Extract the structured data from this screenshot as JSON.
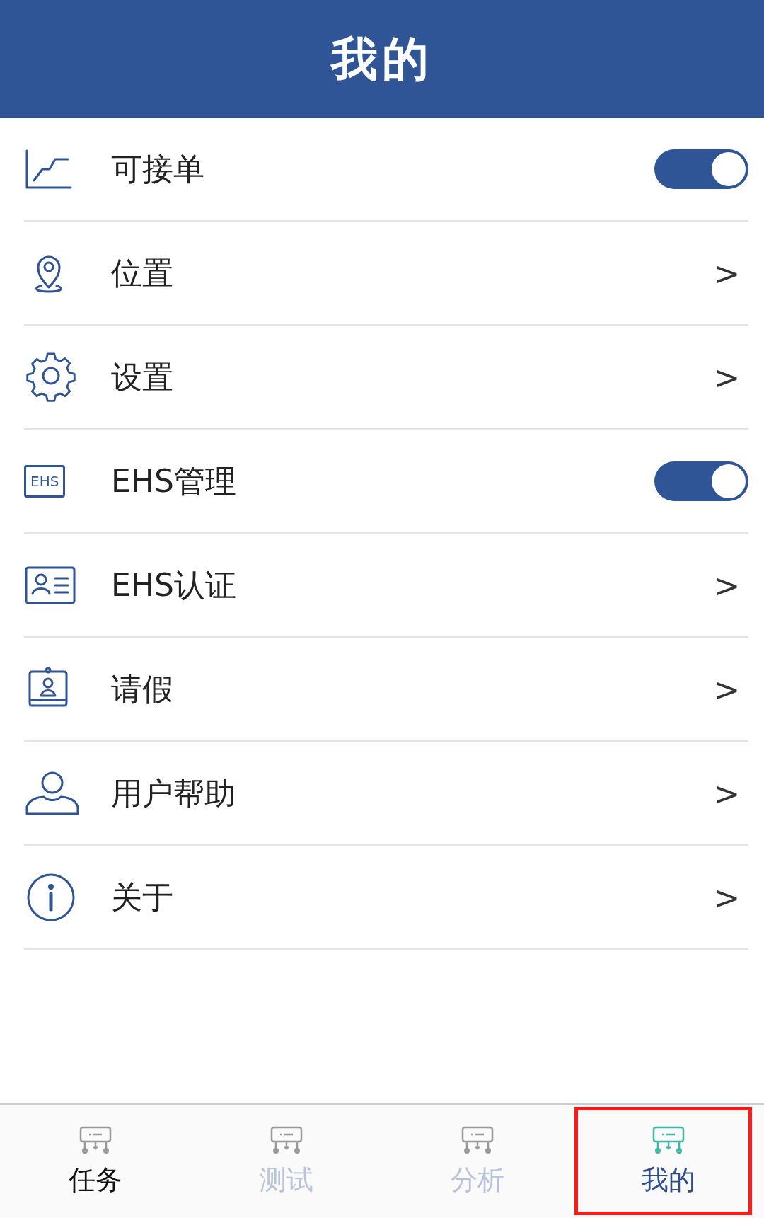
{
  "header": {
    "title": "我的"
  },
  "items": [
    {
      "kind": "toggle",
      "label": "可接单",
      "on": true
    },
    {
      "kind": "link",
      "label": "位置",
      "chevron": ">"
    },
    {
      "kind": "link",
      "label": "设置",
      "chevron": ">"
    },
    {
      "kind": "toggle",
      "label": "EHS管理",
      "on": true,
      "icon_text": "EHS"
    },
    {
      "kind": "link",
      "label": "EHS认证",
      "chevron": ">"
    },
    {
      "kind": "link",
      "label": "请假",
      "chevron": ">"
    },
    {
      "kind": "link",
      "label": "用户帮助",
      "chevron": ">"
    },
    {
      "kind": "link",
      "label": "关于",
      "chevron": ">"
    }
  ],
  "tab_bar": [
    {
      "label": "任务",
      "selected": false,
      "active": true,
      "marked": false
    },
    {
      "label": "测试",
      "selected": false,
      "active": false,
      "marked": false
    },
    {
      "label": "分析",
      "selected": false,
      "active": false,
      "marked": false
    },
    {
      "label": "我的",
      "selected": true,
      "active": false,
      "marked": true
    }
  ]
}
